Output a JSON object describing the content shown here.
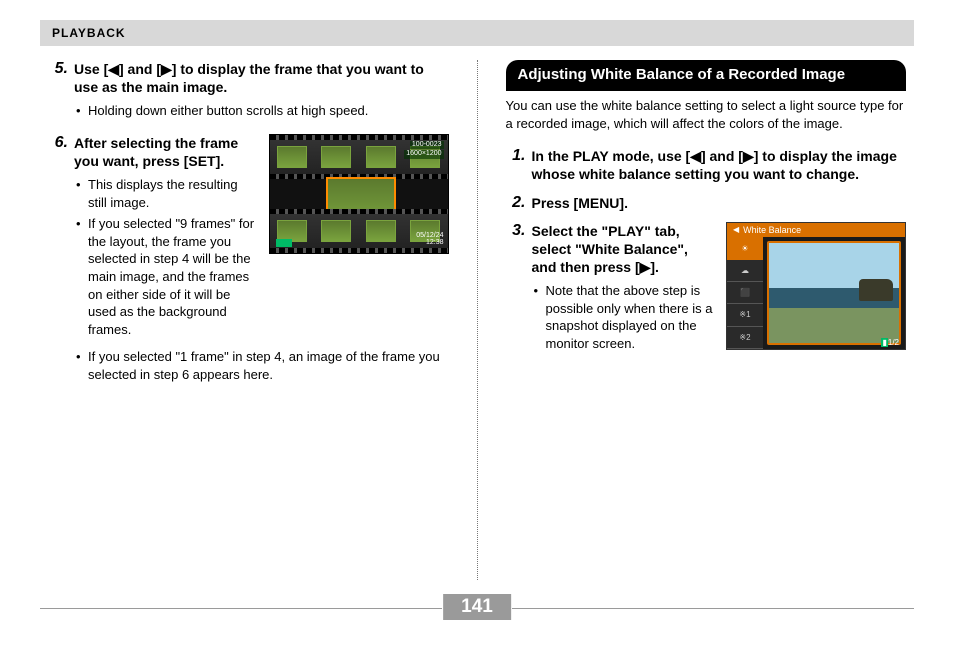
{
  "header": {
    "section": "PLAYBACK"
  },
  "left": {
    "step5": {
      "num": "5.",
      "lead": "Use [◀] and [▶] to display the frame that you want to use as the main image.",
      "bullets": [
        "Holding down either button scrolls at high speed."
      ]
    },
    "step6": {
      "num": "6.",
      "lead": "After selecting the frame you want, press [SET].",
      "bullets_col": [
        "This displays the resulting still image.",
        "If you selected \"9 frames\" for the layout, the frame you selected in step 4 will be the main image, and the frames on either side of it will be used as the background frames."
      ],
      "bullets_full": [
        "If you selected \"1 frame\" in step 4, an image of the frame you selected in step 6 appears here."
      ]
    },
    "cam1": {
      "file": "100-0023",
      "size": "1600×1200",
      "date": "05/12/24",
      "time": "12:38"
    }
  },
  "right": {
    "title": "Adjusting White Balance of a Recorded Image",
    "intro": "You can use the white balance setting to select a light source type for a recorded image, which will affect the colors of the image.",
    "step1": {
      "num": "1.",
      "lead": "In the PLAY mode, use [◀] and [▶] to display the image whose white balance setting you want to change."
    },
    "step2": {
      "num": "2.",
      "lead": "Press [MENU]."
    },
    "step3": {
      "num": "3.",
      "lead": "Select the \"PLAY\" tab, select \"White Balance\", and then press [▶].",
      "bullets": [
        "Note that the above step is possible only when there is a snapshot displayed on the monitor screen."
      ]
    },
    "cam2": {
      "title": "White Balance",
      "items": [
        "☀",
        "☁",
        "⬛",
        "※1",
        "※2"
      ],
      "page": "1/2"
    }
  },
  "pagenum": "141"
}
